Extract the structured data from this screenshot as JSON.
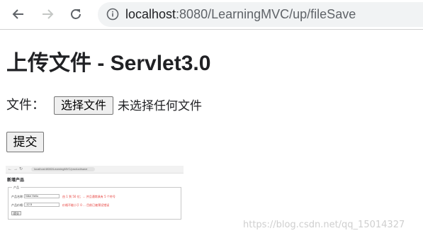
{
  "browser": {
    "url_host": "localhost",
    "url_rest": ":8080/LearningMVC/up/fileSave"
  },
  "page": {
    "title": "上传文件 - Servlet3.0",
    "file_label": "文件：",
    "file_button": "选择文件",
    "file_status": "未选择任何文件",
    "submit_button": "提交"
  },
  "thumbnail": {
    "url": "localhost:8080/LearningMVC/product/save",
    "title": "新增产品",
    "legend": "产品",
    "fields": [
      {
        "label": "产品名称:",
        "value": "Nike Hello",
        "error": "由 1 到 50 位；... 并且通常具有 5 个符号"
      },
      {
        "label": "产品价格:",
        "value": "-12.5",
        "error": "价格不能小于 0 ... 目前已被预设错误"
      }
    ],
    "submit": "提交"
  },
  "watermark": "https://blog.csdn.net/qq_15014327"
}
